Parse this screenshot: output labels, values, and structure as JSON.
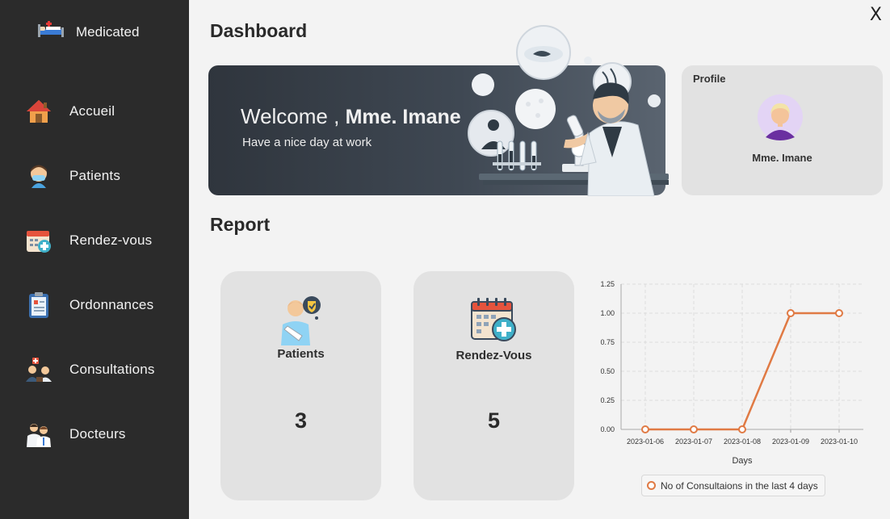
{
  "sidebar": {
    "brand": "Medicated",
    "items": [
      {
        "label": "Accueil",
        "icon": "home-icon"
      },
      {
        "label": "Patients",
        "icon": "patient-icon"
      },
      {
        "label": "Rendez-vous",
        "icon": "calendar-icon"
      },
      {
        "label": "Ordonnances",
        "icon": "prescription-icon"
      },
      {
        "label": "Consultations",
        "icon": "consultation-icon"
      },
      {
        "label": "Docteurs",
        "icon": "doctors-icon"
      }
    ]
  },
  "window": {
    "close_label": "X"
  },
  "dashboard": {
    "title": "Dashboard",
    "welcome_prefix": "Welcome ,",
    "welcome_name": "Mme. Imane",
    "welcome_sub": "Have a nice day at work"
  },
  "profile": {
    "title": "Profile",
    "name": "Mme. Imane"
  },
  "report": {
    "title": "Report",
    "cards": [
      {
        "label": "Patients",
        "value": "3",
        "icon": "patient-icon"
      },
      {
        "label": "Rendez-Vous",
        "value": "5",
        "icon": "calendar-icon"
      }
    ]
  },
  "chart_data": {
    "type": "line",
    "x": [
      "2023-01-06",
      "2023-01-07",
      "2023-01-08",
      "2023-01-09",
      "2023-01-10"
    ],
    "series": [
      {
        "name": "No of Consultaions in the last 4 days",
        "values": [
          0,
          0,
          0,
          1,
          1
        ]
      }
    ],
    "xlabel": "Days",
    "ylabel": "",
    "ylim": [
      0,
      1.25
    ],
    "yticks": [
      "0.00",
      "0.25",
      "0.50",
      "0.75",
      "1.00",
      "1.25"
    ],
    "grid": true,
    "legend_position": "bottom",
    "color": "#e07a44"
  }
}
